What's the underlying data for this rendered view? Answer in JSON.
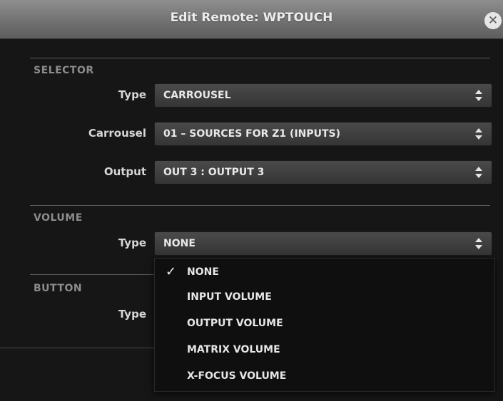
{
  "dialog": {
    "title": "Edit Remote: WPTOUCH",
    "close_icon": "close-icon"
  },
  "selector": {
    "section_label": "SELECTOR",
    "type_label": "Type",
    "type_value": "CARROUSEL",
    "carrousel_label": "Carrousel",
    "carrousel_value": "01 – SOURCES FOR Z1 (INPUTS)",
    "output_label": "Output",
    "output_value": "OUT 3 : OUTPUT 3"
  },
  "volume": {
    "section_label": "VOLUME",
    "type_label": "Type",
    "type_value": "NONE"
  },
  "button": {
    "section_label": "BUTTON",
    "type_label": "Type"
  },
  "dropdown": {
    "options": [
      "NONE",
      "INPUT VOLUME",
      "OUTPUT VOLUME",
      "MATRIX VOLUME",
      "X-FOCUS VOLUME"
    ],
    "selected": "NONE",
    "check_mark": "✓"
  },
  "icons": {
    "select_arrows": "up-down-arrows-icon",
    "check": "checkmark-icon"
  }
}
